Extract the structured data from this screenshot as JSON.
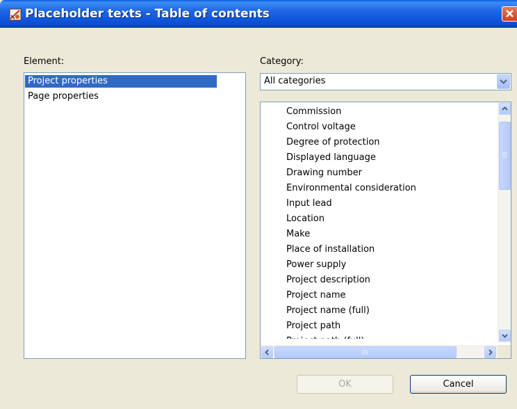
{
  "window": {
    "title": "Placeholder texts - Table of contents"
  },
  "element_panel": {
    "label": "Element:",
    "items": [
      {
        "label": "Project properties",
        "selected": true
      },
      {
        "label": "Page properties",
        "selected": false
      }
    ]
  },
  "category_panel": {
    "label": "Category:",
    "selected": "All categories"
  },
  "placeholder_list": {
    "items": [
      "Commission",
      "Control voltage",
      "Degree of protection",
      "Displayed language",
      "Drawing number",
      "Environmental consideration",
      "Input lead",
      "Location",
      "Make",
      "Place of installation",
      "Power supply",
      "Project description",
      "Project name",
      "Project name (full)",
      "Project path",
      "Project path (full)"
    ]
  },
  "buttons": {
    "ok": "OK",
    "cancel": "Cancel"
  },
  "colors": {
    "titlebar": "#0b4fd4",
    "selection": "#316ac5",
    "dialog_bg": "#ece9d8",
    "close_button": "#c9431c"
  }
}
